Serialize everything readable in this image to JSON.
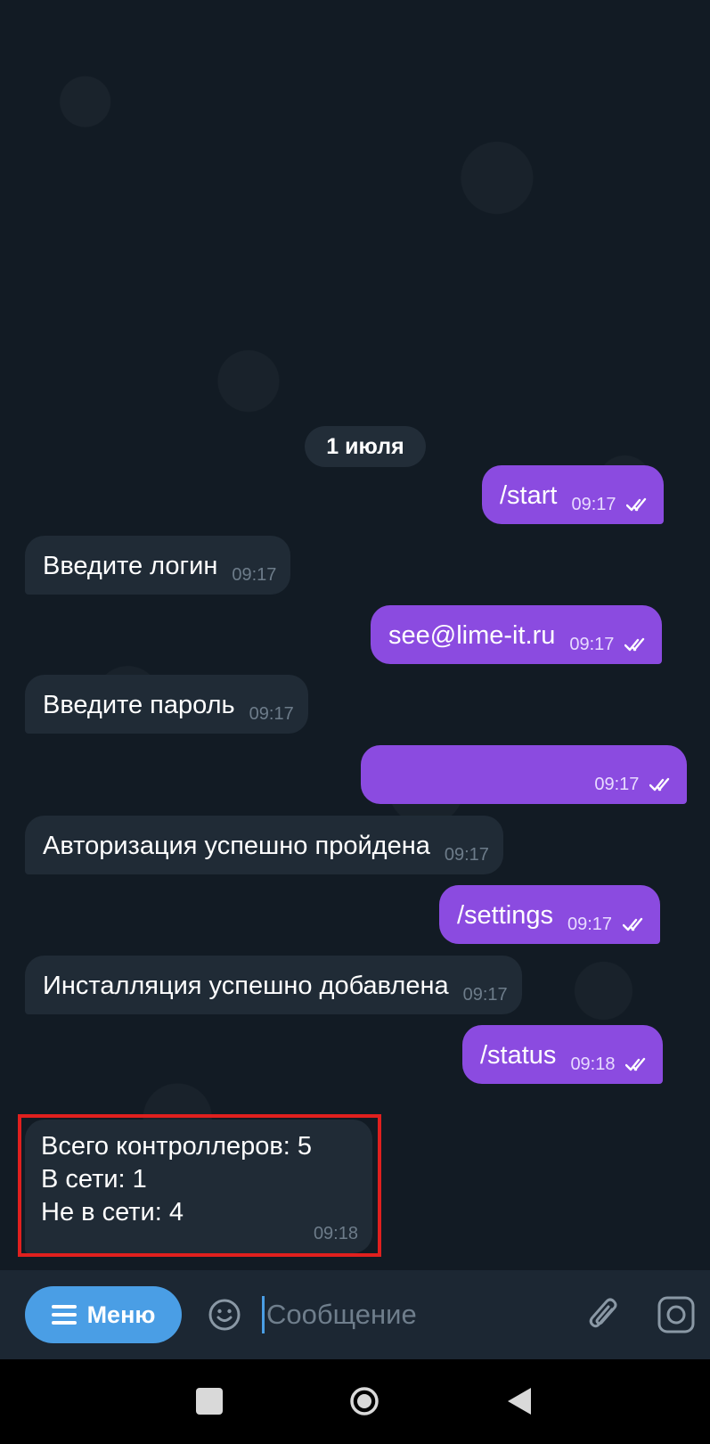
{
  "date_divider": "1 июля",
  "messages": [
    {
      "text": "/start",
      "time": "09:17"
    },
    {
      "text": "Введите логин",
      "time": "09:17"
    },
    {
      "text": "see@lime-it.ru",
      "time": "09:17"
    },
    {
      "text": "Введите пароль",
      "time": "09:17"
    },
    {
      "text": "",
      "time": "09:17"
    },
    {
      "text": "Авторизация успешно пройдена",
      "time": "09:17"
    },
    {
      "text": "/settings",
      "time": "09:17"
    },
    {
      "text": "Инсталляция успешно добавлена",
      "time": "09:17"
    },
    {
      "text": "/status",
      "time": "09:18"
    }
  ],
  "status_message": {
    "lines": [
      "Всего контроллеров: 5",
      "В сети: 1",
      "Не в сети: 4"
    ],
    "time": "09:18"
  },
  "input_bar": {
    "menu_label": "Меню",
    "placeholder": "Сообщение"
  },
  "colors": {
    "outgoing_bubble": "#8b4be0",
    "incoming_bubble": "#202b36",
    "chat_background": "#121b24",
    "menu_button": "#4a9ee5",
    "highlight_border": "#e0201e"
  },
  "icons": [
    "double-check-icon",
    "menu-icon",
    "emoji-icon",
    "attach-icon",
    "camera-icon",
    "nav-square-icon",
    "nav-home-icon",
    "nav-back-icon"
  ]
}
